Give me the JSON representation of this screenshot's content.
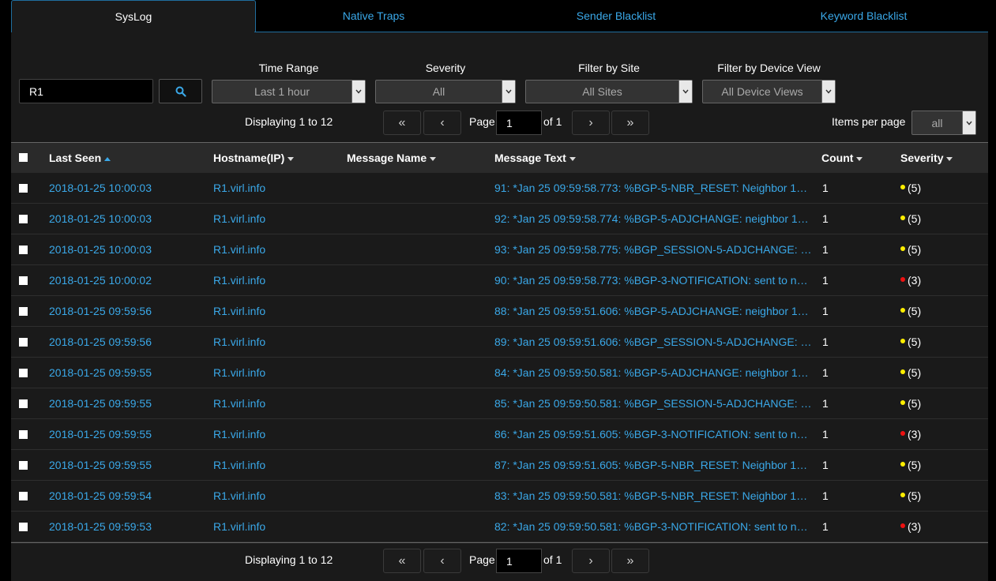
{
  "tabs": [
    {
      "label": "SysLog"
    },
    {
      "label": "Native Traps"
    },
    {
      "label": "Sender Blacklist"
    },
    {
      "label": "Keyword Blacklist"
    }
  ],
  "filters": {
    "search_value": "R1",
    "time_range_label": "Time Range",
    "time_range_value": "Last 1 hour",
    "severity_label": "Severity",
    "severity_value": "All",
    "site_label": "Filter by Site",
    "site_value": "All Sites",
    "device_view_label": "Filter by Device View",
    "device_view_value": "All Device Views"
  },
  "pager": {
    "displaying": "Displaying 1 to 12",
    "first": "«",
    "prev": "‹",
    "page_label": "Page",
    "page_value": "1",
    "of_label": "of 1",
    "next": "›",
    "last": "»",
    "items_per_page_label": "Items per page",
    "items_per_page_value": "all"
  },
  "table": {
    "headers": {
      "last_seen": "Last Seen",
      "hostname": "Hostname(IP)",
      "message_name": "Message Name",
      "message_text": "Message Text",
      "count": "Count",
      "severity": "Severity"
    },
    "rows": [
      {
        "last_seen": "2018-01-25 10:00:03",
        "hostname": "R1.virl.info",
        "message_name": "",
        "message_text": "91: *Jan 25 09:59:58.773: %BGP-5-NBR_RESET: Neighbor 1…",
        "count": "1",
        "severity": "(5)",
        "sev_color": "#ffee00"
      },
      {
        "last_seen": "2018-01-25 10:00:03",
        "hostname": "R1.virl.info",
        "message_name": "",
        "message_text": "92: *Jan 25 09:59:58.774: %BGP-5-ADJCHANGE: neighbor 1…",
        "count": "1",
        "severity": "(5)",
        "sev_color": "#ffee00"
      },
      {
        "last_seen": "2018-01-25 10:00:03",
        "hostname": "R1.virl.info",
        "message_name": "",
        "message_text": "93: *Jan 25 09:59:58.775: %BGP_SESSION-5-ADJCHANGE: …",
        "count": "1",
        "severity": "(5)",
        "sev_color": "#ffee00"
      },
      {
        "last_seen": "2018-01-25 10:00:02",
        "hostname": "R1.virl.info",
        "message_name": "",
        "message_text": "90: *Jan 25 09:59:58.773: %BGP-3-NOTIFICATION: sent to n…",
        "count": "1",
        "severity": "(3)",
        "sev_color": "#ee1111"
      },
      {
        "last_seen": "2018-01-25 09:59:56",
        "hostname": "R1.virl.info",
        "message_name": "",
        "message_text": "88: *Jan 25 09:59:51.606: %BGP-5-ADJCHANGE: neighbor 1…",
        "count": "1",
        "severity": "(5)",
        "sev_color": "#ffee00"
      },
      {
        "last_seen": "2018-01-25 09:59:56",
        "hostname": "R1.virl.info",
        "message_name": "",
        "message_text": "89: *Jan 25 09:59:51.606: %BGP_SESSION-5-ADJCHANGE: …",
        "count": "1",
        "severity": "(5)",
        "sev_color": "#ffee00"
      },
      {
        "last_seen": "2018-01-25 09:59:55",
        "hostname": "R1.virl.info",
        "message_name": "",
        "message_text": "84: *Jan 25 09:59:50.581: %BGP-5-ADJCHANGE: neighbor 1…",
        "count": "1",
        "severity": "(5)",
        "sev_color": "#ffee00"
      },
      {
        "last_seen": "2018-01-25 09:59:55",
        "hostname": "R1.virl.info",
        "message_name": "",
        "message_text": "85: *Jan 25 09:59:50.581: %BGP_SESSION-5-ADJCHANGE: …",
        "count": "1",
        "severity": "(5)",
        "sev_color": "#ffee00"
      },
      {
        "last_seen": "2018-01-25 09:59:55",
        "hostname": "R1.virl.info",
        "message_name": "",
        "message_text": "86: *Jan 25 09:59:51.605: %BGP-3-NOTIFICATION: sent to n…",
        "count": "1",
        "severity": "(3)",
        "sev_color": "#ee1111"
      },
      {
        "last_seen": "2018-01-25 09:59:55",
        "hostname": "R1.virl.info",
        "message_name": "",
        "message_text": "87: *Jan 25 09:59:51.605: %BGP-5-NBR_RESET: Neighbor 1…",
        "count": "1",
        "severity": "(5)",
        "sev_color": "#ffee00"
      },
      {
        "last_seen": "2018-01-25 09:59:54",
        "hostname": "R1.virl.info",
        "message_name": "",
        "message_text": "83: *Jan 25 09:59:50.581: %BGP-5-NBR_RESET: Neighbor 1…",
        "count": "1",
        "severity": "(5)",
        "sev_color": "#ffee00"
      },
      {
        "last_seen": "2018-01-25 09:59:53",
        "hostname": "R1.virl.info",
        "message_name": "",
        "message_text": "82: *Jan 25 09:59:50.581: %BGP-3-NOTIFICATION: sent to n…",
        "count": "1",
        "severity": "(3)",
        "sev_color": "#ee1111"
      }
    ]
  },
  "colors": {
    "accent": "#3aa8e8",
    "warning": "#ffee00",
    "error": "#ee1111"
  }
}
